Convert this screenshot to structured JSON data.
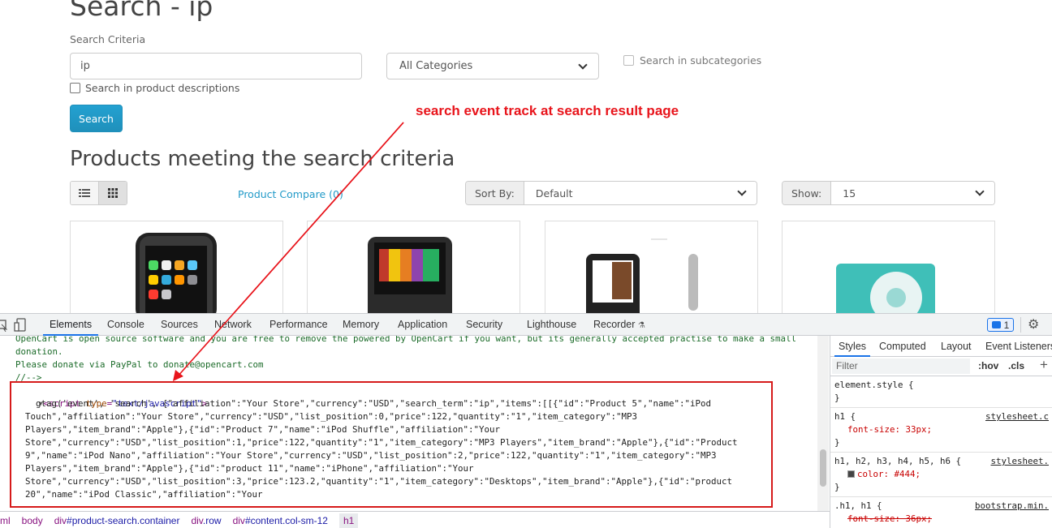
{
  "page": {
    "title": "Search - ip",
    "criteria_label": "Search Criteria",
    "search_value": "ip",
    "category_selected": "All Categories",
    "subcategories_label": "Search in subcategories",
    "descriptions_label": "Search in product descriptions",
    "search_button": "Search",
    "annotation": "search event track at search result page",
    "results_heading": "Products meeting the search criteria",
    "product_compare": "Product Compare (0)",
    "sort_label": "Sort By:",
    "sort_value": "Default",
    "show_label": "Show:",
    "show_value": "15"
  },
  "devtools": {
    "tabs": [
      "Elements",
      "Console",
      "Sources",
      "Network",
      "Performance",
      "Memory",
      "Application",
      "Security",
      "Lighthouse",
      "Recorder"
    ],
    "issues_count": "1",
    "code_lines": [
      "OpenCart is open source software and you are free to remove the powered by OpenCart if you want, but its generally accepted practise to make a small",
      "donation.",
      "Please donate via PayPal to donate@opencart.com",
      "//-->",
      "",
      "  gtag('event', 'search', {\"affiliation\":\"Your Store\",\"currency\":\"USD\",\"search_term\":\"ip\",\"items\":[[{\"id\":\"Product 5\",\"name\":\"iPod",
      "Touch\",\"affiliation\":\"Your Store\",\"currency\":\"USD\",\"list_position\":0,\"price\":122,\"quantity\":\"1\",\"item_category\":\"MP3",
      "Players\",\"item_brand\":\"Apple\"},{\"id\":\"Product 7\",\"name\":\"iPod Shuffle\",\"affiliation\":\"Your",
      "Store\",\"currency\":\"USD\",\"list_position\":1,\"price\":122,\"quantity\":\"1\",\"item_category\":\"MP3 Players\",\"item_brand\":\"Apple\"},{\"id\":\"Product",
      "9\",\"name\":\"iPod Nano\",\"affiliation\":\"Your Store\",\"currency\":\"USD\",\"list_position\":2,\"price\":122,\"quantity\":\"1\",\"item_category\":\"MP3",
      "Players\",\"item_brand\":\"Apple\"},{\"id\":\"product 11\",\"name\":\"iPhone\",\"affiliation\":\"Your",
      "Store\",\"currency\":\"USD\",\"list_position\":3,\"price\":123.2,\"quantity\":\"1\",\"item_category\":\"Desktops\",\"item_brand\":\"Apple\"},{\"id\":\"product",
      "20\",\"name\":\"iPod Classic\",\"affiliation\":\"Your"
    ],
    "script_tag": {
      "open": "<script",
      "attr": "type",
      "value": "\"text/javascript\"",
      "close": ">"
    },
    "breadcrumbs": [
      {
        "n": "ml",
        "c": ""
      },
      {
        "n": "body",
        "c": ""
      },
      {
        "n": "div",
        "c": "#product-search.container"
      },
      {
        "n": "div",
        "c": ".row"
      },
      {
        "n": "div",
        "c": "#content.col-sm-12"
      }
    ],
    "breadcrumb_selected": "h1",
    "styles_tabs": [
      "Styles",
      "Computed",
      "Layout",
      "Event Listeners"
    ],
    "filter_placeholder": "Filter",
    "hov": ":hov",
    "cls": ".cls",
    "rules": [
      {
        "selector": "element.style {",
        "source": "",
        "props": [],
        "end": "}"
      },
      {
        "selector": "h1 {",
        "source": "stylesheet.c",
        "props": [
          "font-size: 33px;"
        ],
        "end": "}"
      },
      {
        "selector": "h1, h2, h3, h4, h5, h6 {",
        "source": "stylesheet.",
        "props": [
          "color: #444;"
        ],
        "end": "}"
      },
      {
        "selector": ".h1, h1 {",
        "source": "bootstrap.min.",
        "props": [
          "font-size: 36px;"
        ],
        "end": "}"
      }
    ]
  }
}
